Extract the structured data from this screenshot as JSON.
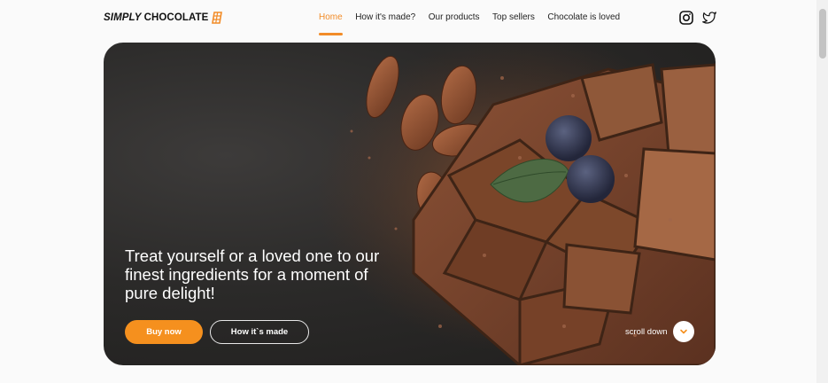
{
  "header": {
    "logo_part1": "SIMPLY",
    "logo_part2": "CHOCOLATE",
    "nav": [
      {
        "label": "Home",
        "active": true
      },
      {
        "label": "How it's made?",
        "active": false
      },
      {
        "label": "Our products",
        "active": false
      },
      {
        "label": "Top sellers",
        "active": false
      },
      {
        "label": "Chocolate is loved",
        "active": false
      }
    ],
    "social": [
      "instagram-icon",
      "twitter-icon"
    ]
  },
  "hero": {
    "headline": "Treat yourself or a loved one to our finest ingredients for a moment of pure delight!",
    "buy_label": "Buy now",
    "how_label": "How it`s made",
    "scroll_label": "scroll down"
  },
  "colors": {
    "accent": "#f28c28",
    "button": "#f5901e",
    "hero_bg": "#2b2a29"
  }
}
